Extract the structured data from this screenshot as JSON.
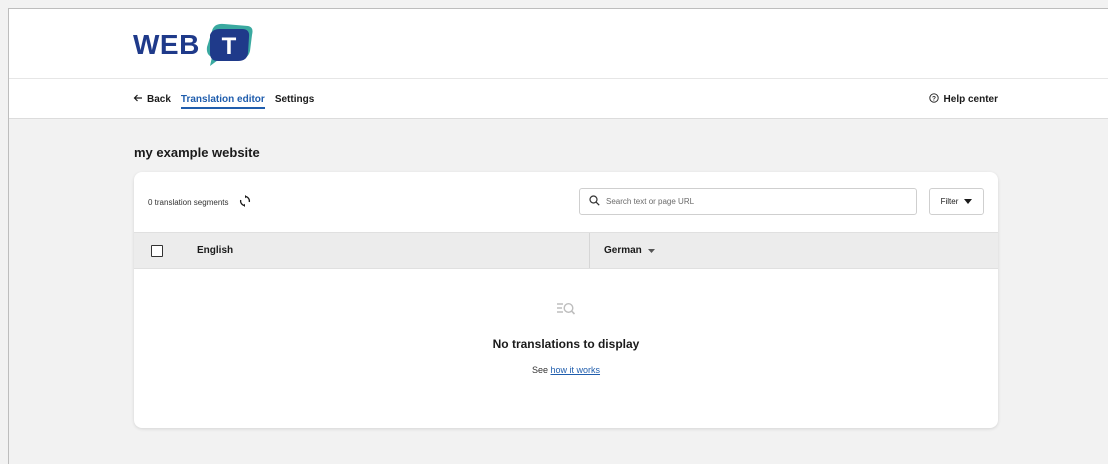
{
  "logo": {
    "text": "WEB",
    "badge_letter": "T"
  },
  "nav": {
    "back_label": "Back",
    "tabs": [
      {
        "label": "Translation editor",
        "active": true
      },
      {
        "label": "Settings",
        "active": false
      }
    ],
    "help_label": "Help center"
  },
  "page": {
    "title": "my example website"
  },
  "toolbar": {
    "segments_label": "0 translation segments",
    "search_placeholder": "Search text or page URL",
    "filter_label": "Filter"
  },
  "table": {
    "columns": [
      "English",
      "German"
    ]
  },
  "empty_state": {
    "title": "No translations to display",
    "sub_prefix": "See",
    "sub_link": "how it works"
  },
  "colors": {
    "brand_blue": "#1f3a8a",
    "accent_blue": "#1f5dad",
    "badge_teal": "#3aa9a0"
  }
}
